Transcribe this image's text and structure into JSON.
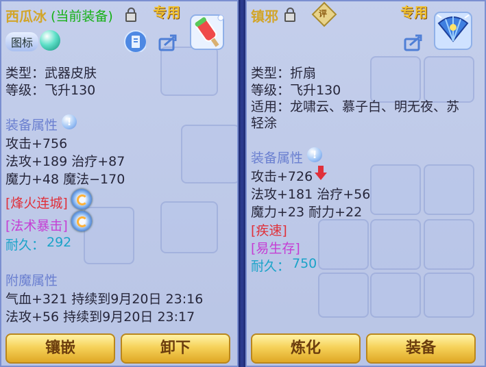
{
  "left": {
    "title": "西瓜冰",
    "title_tag": "(当前装备)",
    "exclusive": "专用",
    "tag_badge": "图标",
    "type_line": "类型：武器皮肤",
    "level_line": "等级：飞升130",
    "attr_header": "装备属性",
    "attack": "攻击+756",
    "stats1": "法攻+189 治疗+87",
    "stats2": "魔力+48 魔法−170",
    "skill1": "[烽火连城]",
    "skill2": "[法术暴击]",
    "durability_label": "耐久：",
    "durability_value": "292",
    "enchant_header": "附魔属性",
    "enchant1": "气血+321 持续到9月20日 23:16",
    "enchant2": "法攻+56 持续到9月20日 23:17",
    "btn_inlay": "镶嵌",
    "btn_unequip": "卸下"
  },
  "right": {
    "title": "镇邪",
    "exclusive": "专用",
    "gem_label": "评",
    "type_line": "类型：折扇",
    "level_line": "等级：飞升130",
    "suit_line1": "适用：龙啸云、慕子白、明无夜、苏",
    "suit_line2": "轻涂",
    "attr_header": "装备属性",
    "attack": "攻击+726",
    "stats1": "法攻+181 治疗+56",
    "stats2": "魔力+23 耐力+22",
    "skill1": "[疾速]",
    "skill2": "[易生存]",
    "durability_label": "耐久：",
    "durability_value": "750",
    "btn_refine": "炼化",
    "btn_equip": "装备"
  },
  "colors": {
    "title": "#d2a52a",
    "current_tag": "#15b015",
    "skill_red": "#e0303a",
    "skill_pink": "#c53dd4",
    "durability": "#1aa3c8",
    "section_header": "#6a7fd0",
    "attack_down": "#e0303a"
  },
  "icons": [
    "lock-icon",
    "info-icon",
    "skill-swirl-icon",
    "export-icon",
    "card-icon",
    "watermelon-popsicle-icon",
    "fan-weapon-icon",
    "down-arrow-icon",
    "gem-icon"
  ]
}
